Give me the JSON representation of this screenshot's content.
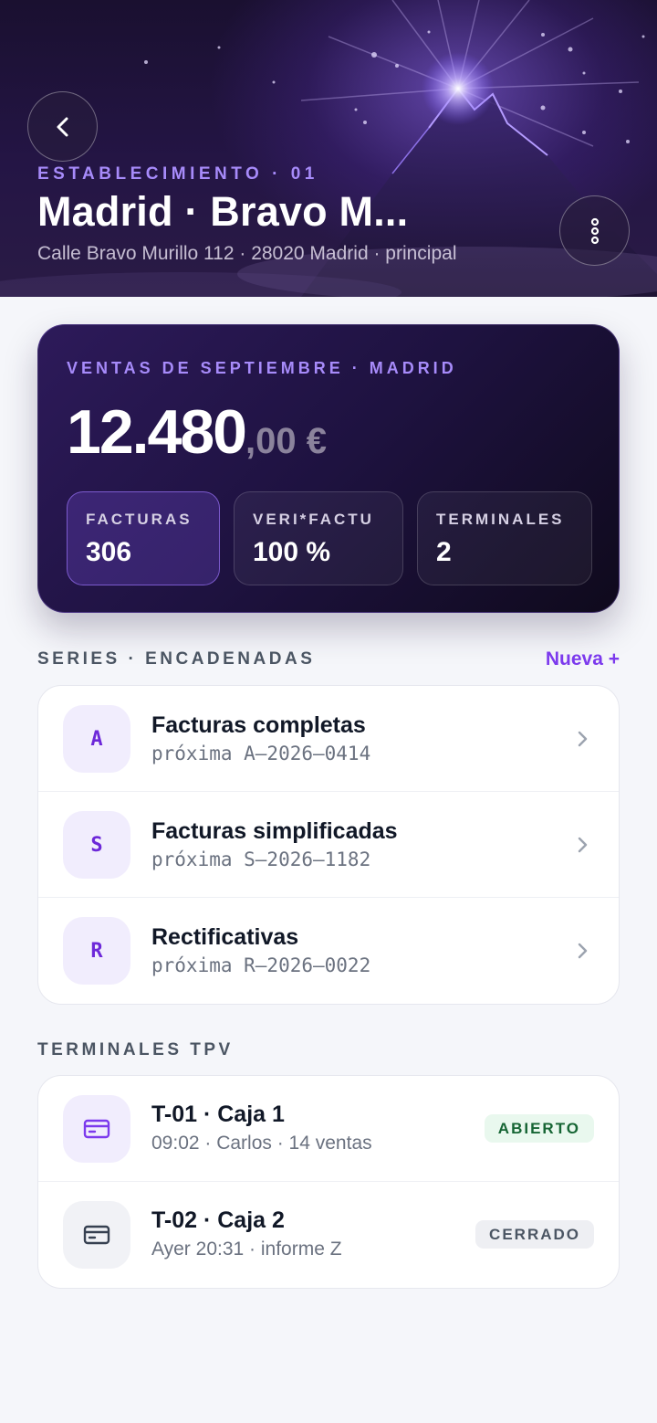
{
  "header": {
    "eyebrow": "ESTABLECIMIENTO · 01",
    "title": "Madrid · Bravo M...",
    "address": "Calle Bravo Murillo 112 · 28020 Madrid · principal",
    "back_icon": "chevron-left-icon",
    "more_icon": "more-vertical-icon"
  },
  "sales": {
    "eyebrow": "VENTAS DE SEPTIEMBRE · MADRID",
    "amount_int": "12.480",
    "amount_dec": ",00 €",
    "stats": [
      {
        "label": "FACTURAS",
        "value": "306"
      },
      {
        "label": "VERI*FACTU",
        "value": "100 %"
      },
      {
        "label": "TERMINALES",
        "value": "2"
      }
    ]
  },
  "series": {
    "label": "SERIES · ENCADENADAS",
    "new_label": "Nueva +",
    "items": [
      {
        "code": "A",
        "title": "Facturas completas",
        "next": "próxima A–2026–0414"
      },
      {
        "code": "S",
        "title": "Facturas simplificadas",
        "next": "próxima S–2026–1182"
      },
      {
        "code": "R",
        "title": "Rectificativas",
        "next": "próxima R–2026–0022"
      }
    ]
  },
  "terminals": {
    "label": "TERMINALES TPV",
    "items": [
      {
        "title": "T-01 · Caja 1",
        "sub": "09:02 · Carlos · 14 ventas",
        "status": "ABIERTO",
        "icon": "credit-card-icon"
      },
      {
        "title": "T-02 · Caja 2",
        "sub": "Ayer 20:31 · informe Z",
        "status": "CERRADO",
        "icon": "credit-card-icon"
      }
    ]
  },
  "colors": {
    "accent": "#7c3aed",
    "accent_light": "#a78bfa",
    "open_green": "#166534",
    "hero_bg": "#1a1030"
  }
}
